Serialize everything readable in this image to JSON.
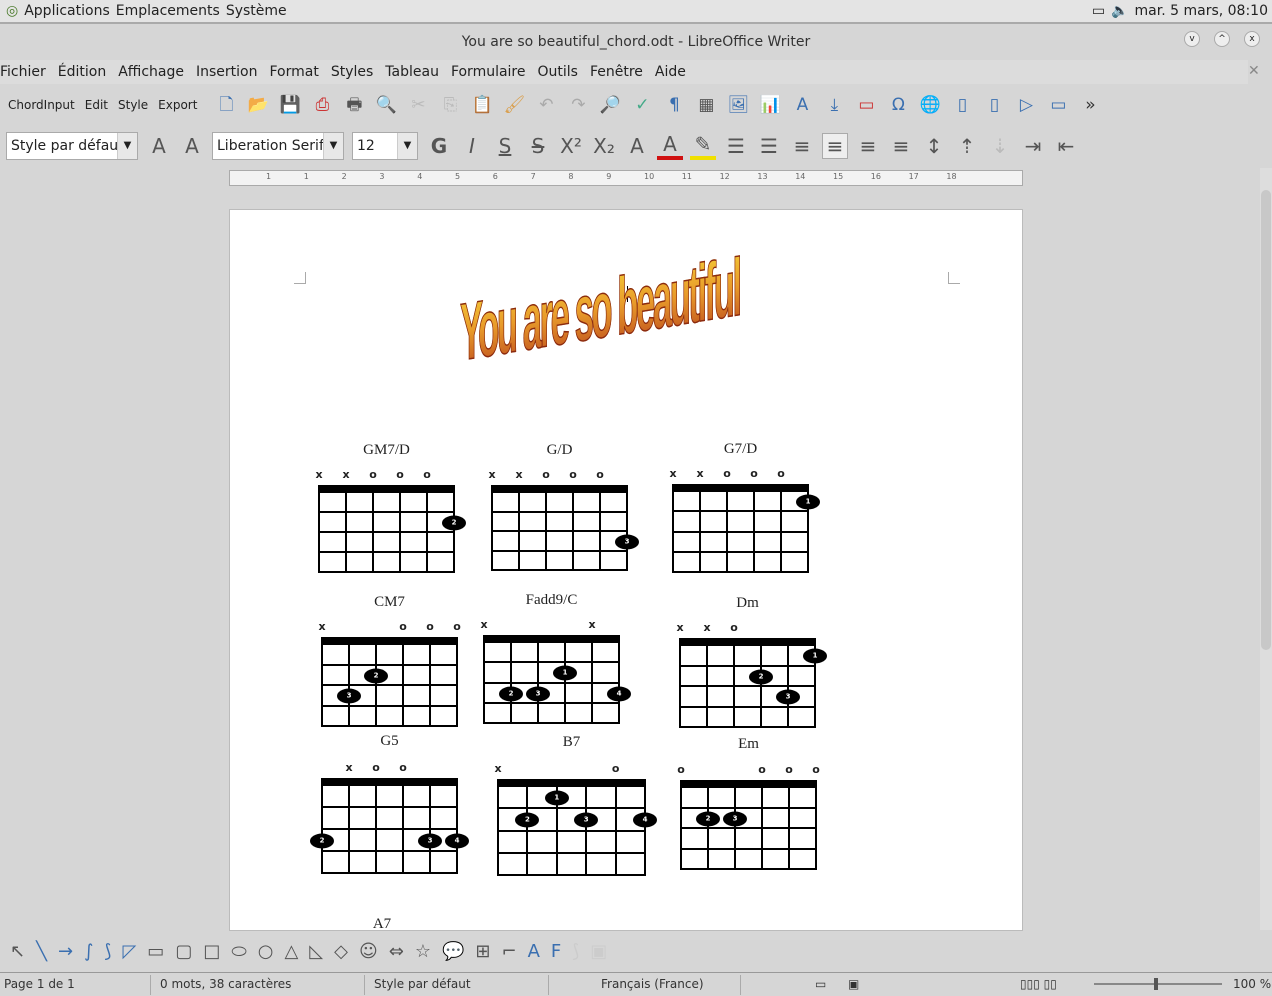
{
  "topbar": {
    "menus": [
      "Applications",
      "Emplacements",
      "Système"
    ],
    "clock": "mar.  5 mars, 08:10"
  },
  "window": {
    "title": "You are so beautiful_chord.odt - LibreOffice Writer"
  },
  "menubar": [
    "Fichier",
    "Édition",
    "Affichage",
    "Insertion",
    "Format",
    "Styles",
    "Tableau",
    "Formulaire",
    "Outils",
    "Fenêtre",
    "Aide"
  ],
  "toolbar1": {
    "ext": [
      "ChordInput",
      "Edit",
      "Style",
      "Export"
    ]
  },
  "toolbar2": {
    "para_style": "Style par défaut",
    "font": "Liberation Serif",
    "size": "12"
  },
  "ruler": [
    "1",
    "1",
    "2",
    "3",
    "4",
    "5",
    "6",
    "7",
    "8",
    "9",
    "10",
    "11",
    "12",
    "13",
    "14",
    "15",
    "16",
    "17",
    "18"
  ],
  "document": {
    "title": "You are so beautiful",
    "chords": [
      {
        "name": "GM7/D",
        "marks": [
          "x",
          "x",
          "o",
          "o",
          "o",
          ""
        ],
        "dots": [
          [
            5,
            2,
            "2"
          ]
        ]
      },
      {
        "name": "G/D",
        "marks": [
          "x",
          "x",
          "o",
          "o",
          "o",
          ""
        ],
        "dots": [
          [
            5,
            3,
            "3"
          ]
        ]
      },
      {
        "name": "G7/D",
        "marks": [
          "x",
          "x",
          "o",
          "o",
          "o",
          ""
        ],
        "dots": [
          [
            5,
            1,
            "1"
          ]
        ]
      },
      {
        "name": "CM7",
        "marks": [
          "x",
          "",
          "",
          "o",
          "o",
          "o"
        ],
        "dots": [
          [
            2,
            2,
            "2"
          ],
          [
            1,
            3,
            "3"
          ]
        ]
      },
      {
        "name": "Fadd9/C",
        "marks": [
          "x",
          "",
          "",
          "",
          "x",
          ""
        ],
        "dots": [
          [
            3,
            2,
            "1"
          ],
          [
            1,
            3,
            "2"
          ],
          [
            2,
            3,
            "3"
          ],
          [
            5,
            3,
            "4"
          ]
        ]
      },
      {
        "name": "Dm",
        "marks": [
          "x",
          "x",
          "o",
          "",
          "",
          ""
        ],
        "dots": [
          [
            5,
            1,
            "1"
          ],
          [
            3,
            2,
            "2"
          ],
          [
            4,
            3,
            "3"
          ]
        ]
      },
      {
        "name": "G5",
        "marks": [
          "",
          "x",
          "o",
          "o",
          "",
          ""
        ],
        "dots": [
          [
            0,
            3,
            "2"
          ],
          [
            4,
            3,
            "3"
          ],
          [
            5,
            3,
            "4"
          ]
        ]
      },
      {
        "name": "B7",
        "marks": [
          "x",
          "",
          "",
          "",
          "o",
          ""
        ],
        "dots": [
          [
            2,
            1,
            "1"
          ],
          [
            1,
            2,
            "2"
          ],
          [
            3,
            2,
            "3"
          ],
          [
            5,
            2,
            "4"
          ]
        ]
      },
      {
        "name": "Em",
        "marks": [
          "o",
          "",
          "",
          "o",
          "o",
          "o"
        ],
        "dots": [
          [
            1,
            2,
            "2"
          ],
          [
            2,
            2,
            "3"
          ]
        ]
      }
    ],
    "next_chord": "A7"
  },
  "status": {
    "page": "Page 1 de 1",
    "words": "0 mots, 38 caractères",
    "style": "Style par défaut",
    "lang": "Français (France)",
    "zoom": "100 %"
  }
}
